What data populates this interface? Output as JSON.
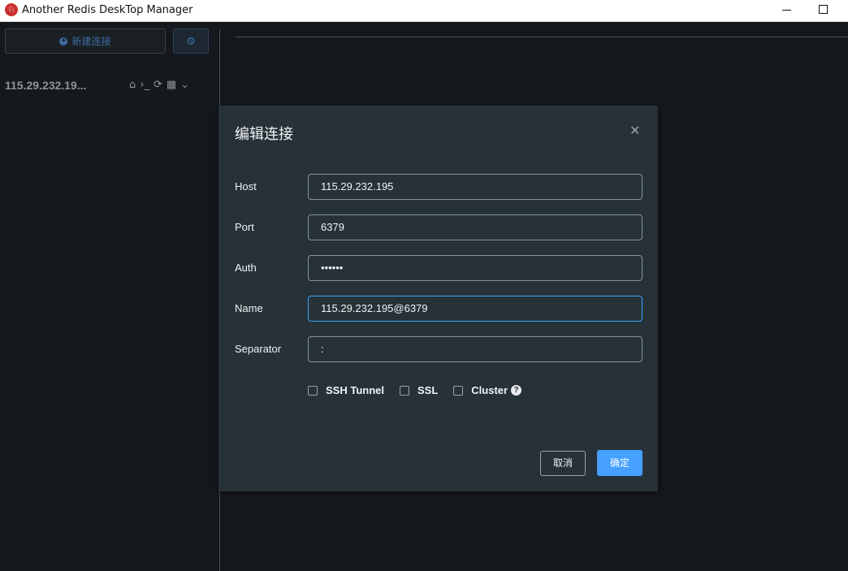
{
  "window": {
    "title": "Another Redis DeskTop Manager",
    "logo_glyph": "♘"
  },
  "sidebar": {
    "new_connection_label": "新建连接",
    "connection": {
      "name": "115.29.232.19...",
      "icons": [
        "home-icon",
        "terminal-icon",
        "refresh-icon",
        "grid-icon",
        "chevron-down-icon"
      ]
    }
  },
  "dialog": {
    "title": "编辑连接",
    "fields": {
      "host": {
        "label": "Host",
        "value": "115.29.232.195"
      },
      "port": {
        "label": "Port",
        "value": "6379"
      },
      "auth": {
        "label": "Auth",
        "value": "••••••"
      },
      "name": {
        "label": "Name",
        "value": "115.29.232.195@6379"
      },
      "separator": {
        "label": "Separator",
        "value": ":"
      }
    },
    "options": {
      "ssh_tunnel": "SSH Tunnel",
      "ssl": "SSL",
      "cluster": "Cluster"
    },
    "cancel_label": "取消",
    "ok_label": "确定"
  },
  "colors": {
    "accent": "#45a0ff",
    "dialog_bg": "#263238",
    "app_bg": "#15191d"
  }
}
